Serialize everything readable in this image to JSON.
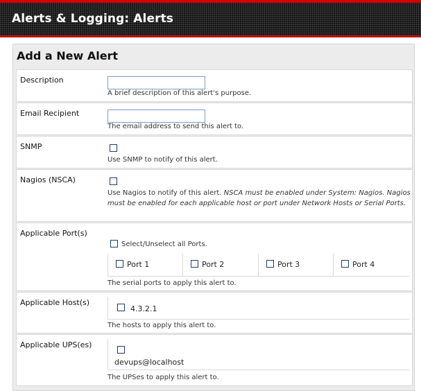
{
  "header": {
    "title": "Alerts & Logging: Alerts"
  },
  "panel": {
    "title": "Add a New Alert"
  },
  "description": {
    "label": "Description",
    "value": "",
    "hint": "A brief description of this alert's purpose."
  },
  "email": {
    "label": "Email Recipient",
    "value": "",
    "hint": "The email address to send this alert to."
  },
  "snmp": {
    "label": "SNMP",
    "checked": false,
    "hint": "Use SNMP to notify of this alert."
  },
  "nagios": {
    "label": "Nagios (NSCA)",
    "checked": false,
    "hint_plain": "Use Nagios to notify of this alert. ",
    "hint_italic": "NSCA must be enabled under System: Nagios. Nagios must be enabled for each applicable host or port under Network Hosts or Serial Ports."
  },
  "ports": {
    "label": "Applicable Port(s)",
    "select_all": "Select/Unselect all Ports.",
    "items": [
      {
        "label": "Port 1",
        "checked": false
      },
      {
        "label": "Port 2",
        "checked": false
      },
      {
        "label": "Port 3",
        "checked": false
      },
      {
        "label": "Port 4",
        "checked": false
      }
    ],
    "hint": "The serial ports to apply this alert to."
  },
  "hosts": {
    "label": "Applicable Host(s)",
    "items": [
      {
        "label": "4.3.2.1",
        "checked": false
      }
    ],
    "hint": "The hosts to apply this alert to."
  },
  "ups": {
    "label": "Applicable UPS(es)",
    "items": [
      {
        "label": "devups@localhost",
        "checked": false
      }
    ],
    "hint": "The UPSes to apply this alert to."
  }
}
